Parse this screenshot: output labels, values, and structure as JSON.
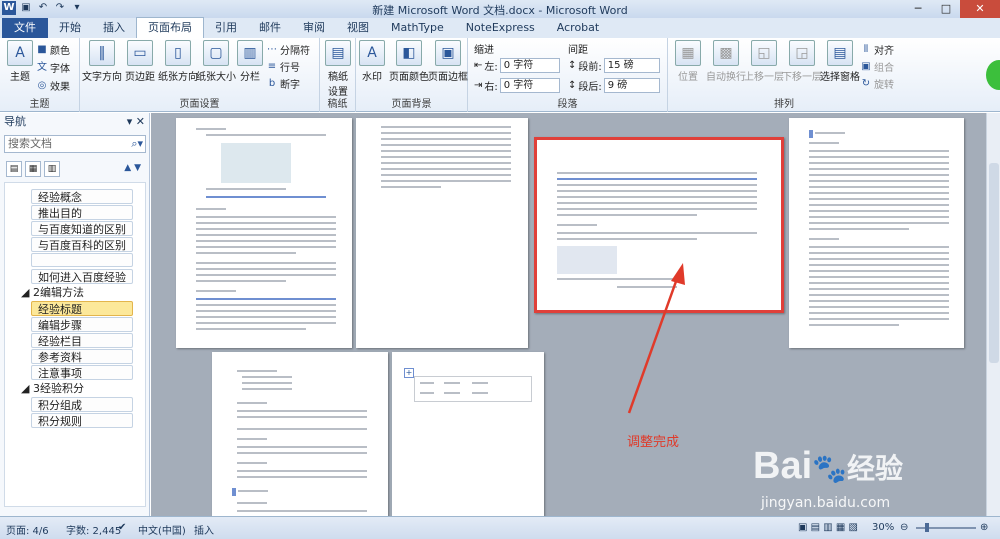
{
  "window": {
    "title": "新建 Microsoft Word 文档.docx - Microsoft Word"
  },
  "tabs": [
    "文件",
    "开始",
    "插入",
    "页面布局",
    "引用",
    "邮件",
    "审阅",
    "视图",
    "MathType",
    "NoteExpress",
    "Acrobat"
  ],
  "ribbon": {
    "theme": {
      "big": "主题",
      "colors": "颜色",
      "fonts": "字体",
      "effects": "效果",
      "label": "主题"
    },
    "page_setup": {
      "text_dir": "文字方向",
      "margins": "页边距",
      "orientation": "纸张方向",
      "size": "纸张大小",
      "columns": "分栏",
      "breaks": "分隔符",
      "line_numbers": "行号",
      "hyphen": "断字",
      "label": "页面设置"
    },
    "draft": {
      "item": "稿纸\n设置",
      "label": "稿纸"
    },
    "background": {
      "watermark": "水印",
      "page_color": "页面颜色",
      "page_border": "页面边框",
      "label": "页面背景"
    },
    "paragraph": {
      "indent": "缩进",
      "left_label": "左:",
      "left_value": "0 字符",
      "right_label": "右:",
      "right_value": "0 字符",
      "spacing": "间距",
      "before_label": "段前:",
      "before_value": "15 磅",
      "after_label": "段后:",
      "after_value": "9 磅",
      "label": "段落"
    },
    "arrange": {
      "position": "位置",
      "wrap": "自动换行",
      "forward": "上移一层",
      "backward": "下移一层",
      "selection_pane": "选择窗格",
      "align": "对齐",
      "group": "组合",
      "rotate": "旋转",
      "label": "排列"
    }
  },
  "nav": {
    "title": "导航",
    "search_placeholder": "搜索文档",
    "items": [
      "经验概念",
      "推出目的",
      "与百度知道的区别",
      "与百度百科的区别",
      "",
      "如何进入百度经验",
      "2编辑方法",
      "经验标题",
      "编辑步骤",
      "经验栏目",
      "参考资料",
      "注意事项",
      "3经验积分",
      "积分组成",
      "积分规则"
    ]
  },
  "annotation": "调整完成",
  "status": {
    "page": "页面: 4/6",
    "words": "字数: 2,445",
    "lang": "中文(中国)",
    "insert": "插入",
    "zoom": "30%"
  },
  "watermark": {
    "brand": "Bai",
    "brand2": "经验",
    "url": "jingyan.baidu.com"
  },
  "colors": {
    "accent": "#2b579a",
    "highlight": "#e03a2a"
  }
}
